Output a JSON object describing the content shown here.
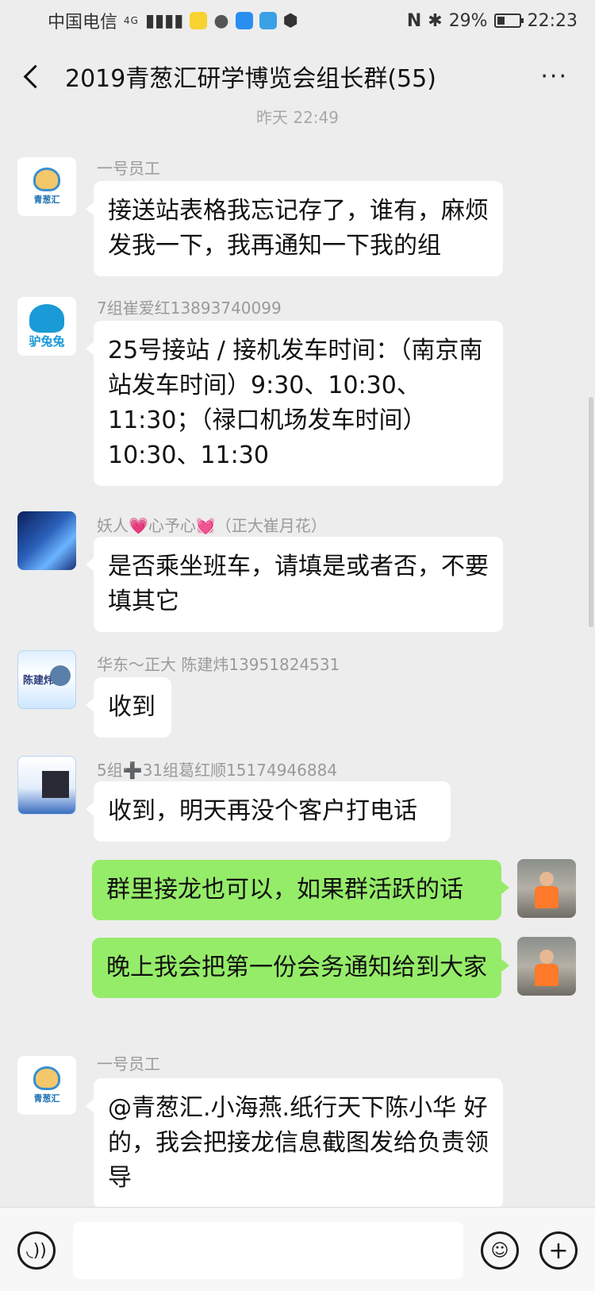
{
  "status_bar": {
    "carrier": "中国电信",
    "signal": "4G",
    "battery": "29%",
    "time": "22:23"
  },
  "header": {
    "title": "2019青葱汇研学博览会组长群(55)",
    "more": "···"
  },
  "timestamp": "昨天 22:49",
  "messages": [
    {
      "sender": "一号员工",
      "text": "接送站表格我忘记存了，谁有，麻烦发我一下，我再通知一下我的组",
      "avatar_text": "青葱汇"
    },
    {
      "sender": "7组崔爱红13893740099",
      "text": "25号接站 / 接机发车时间：（南京南站发车时间）9:30、10:30、11:30；（禄口机场发车时间）10:30、11:30",
      "avatar_text": "驴兔兔"
    },
    {
      "sender": "妖人💗心予心💓（正大崔月花）",
      "text": "是否乘坐班车，请填是或者否，不要填其它"
    },
    {
      "sender": "华东～正大 陈建炜13951824531",
      "text": "收到",
      "avatar_text": "陈建炜"
    },
    {
      "sender": "5组➕31组葛红顺15174946884",
      "text": "收到，明天再没个客户打电话"
    },
    {
      "text": "群里接龙也可以，如果群活跃的话"
    },
    {
      "text": "晚上我会把第一份会务通知给到大家"
    },
    {
      "sender": "一号员工",
      "text": "@青葱汇.小海燕.纸行天下陈小华 好的，我会把接龙信息截图发给负责领导",
      "avatar_text": "青葱汇"
    }
  ],
  "input_bar": {
    "voice_icon": "voice-icon",
    "emoji_icon": "emoji-icon",
    "plus_icon": "plus-icon"
  },
  "colors": {
    "background": "#ededed",
    "self_bubble": "#95ec69",
    "other_bubble": "#ffffff"
  }
}
